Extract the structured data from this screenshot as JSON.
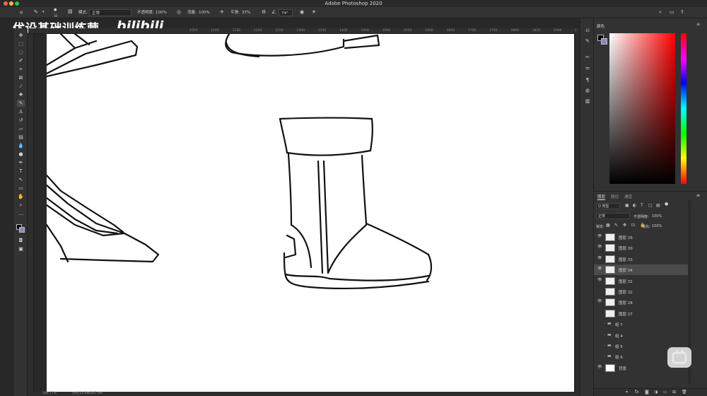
{
  "app": {
    "title": "Adobe Photoshop 2020"
  },
  "watermark": {
    "text": "优设基础训练营",
    "logo": "bilibili"
  },
  "options_bar": {
    "brush_size": "10",
    "mode_label": "模式:",
    "mode_value": "正常",
    "opacity_label": "不透明度:",
    "opacity_value": "100%",
    "flow_label": "流量:",
    "flow_value": "100%",
    "smoothing_label": "平滑:",
    "smoothing_value": "37%",
    "angle_value": "74°"
  },
  "ruler_top": {
    "ticks": [
      "1050",
      "1100",
      "1150",
      "1200",
      "1250",
      "1300",
      "1350",
      "1400",
      "1450",
      "1500",
      "1550",
      "1600",
      "1650",
      "1700",
      "1750",
      "1800",
      "1850",
      "1900",
      "1950",
      "2000",
      "2050",
      "2100",
      "2150"
    ]
  },
  "status": {
    "zoom": "166.77%",
    "doc": "文档:24.9M/267.6M"
  },
  "color_panel": {
    "tab": "颜色",
    "fg_color": "#000000",
    "bg_color": "#8e86c9"
  },
  "layers_panel": {
    "tabs": [
      "图层",
      "路径",
      "通道"
    ],
    "filter_label": "Q 类型",
    "blend_mode": "正常",
    "opacity_label": "不透明度:",
    "opacity_value": "100%",
    "lock_label": "锁定:",
    "fill_label": "填充:",
    "fill_value": "100%",
    "layers": [
      {
        "name": "图层 26",
        "visible": true,
        "type": "layer",
        "selected": false
      },
      {
        "name": "图层 30",
        "visible": true,
        "type": "layer",
        "selected": false
      },
      {
        "name": "图层 33",
        "visible": true,
        "type": "layer",
        "selected": false
      },
      {
        "name": "图层 34",
        "visible": true,
        "type": "layer",
        "selected": true
      },
      {
        "name": "图层 31",
        "visible": true,
        "type": "layer",
        "selected": false
      },
      {
        "name": "图层 32",
        "visible": false,
        "type": "layer",
        "selected": false
      },
      {
        "name": "图层 28",
        "visible": true,
        "type": "layer",
        "selected": false
      },
      {
        "name": "图层 27",
        "visible": false,
        "type": "layer",
        "selected": false
      },
      {
        "name": "组 7",
        "visible": false,
        "type": "group",
        "selected": false
      },
      {
        "name": "组 4",
        "visible": false,
        "type": "group",
        "selected": false
      },
      {
        "name": "组 5",
        "visible": false,
        "type": "group",
        "selected": false
      },
      {
        "name": "组 6",
        "visible": false,
        "type": "group",
        "selected": false
      },
      {
        "name": "背景",
        "visible": true,
        "type": "background",
        "selected": false
      }
    ]
  }
}
